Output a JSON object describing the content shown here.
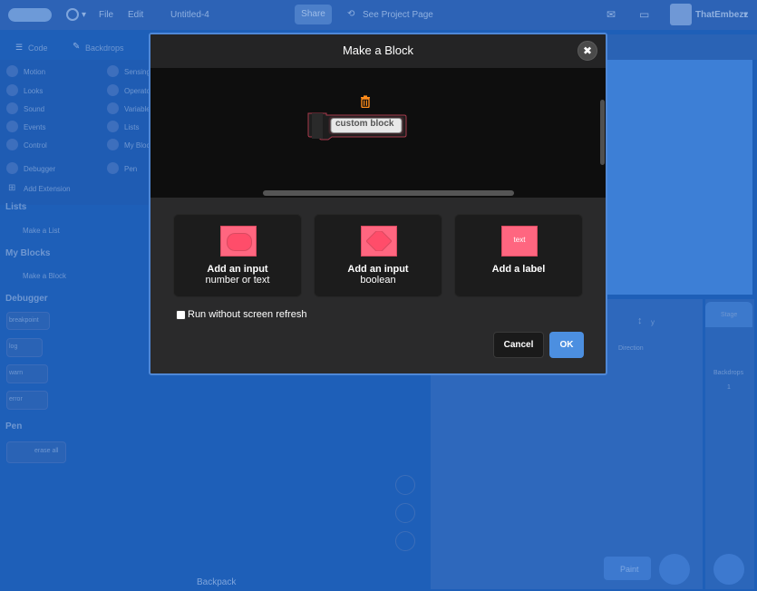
{
  "menubar": {
    "file_label": "File",
    "edit_label": "Edit",
    "project_title": "Untitled-4",
    "share_label": "Share",
    "see_project_label": "See Project Page",
    "username": "ThatEmbezz"
  },
  "tabs": {
    "code_label": "Code",
    "backdrops_label": "Backdrops"
  },
  "categories": [
    {
      "label": "Motion",
      "color": "#4c97ff"
    },
    {
      "label": "Looks",
      "color": "#9966ff"
    },
    {
      "label": "Sound",
      "color": "#cf63cf"
    },
    {
      "label": "Events",
      "color": "#ffbf00"
    },
    {
      "label": "Control",
      "color": "#ffab19"
    },
    {
      "label": "Debugger",
      "color": "#4c97ff"
    },
    {
      "label": "Sensing",
      "color": "#5cb1d6"
    },
    {
      "label": "Operators",
      "color": "#59c059"
    },
    {
      "label": "Variables",
      "color": "#ff8c1a"
    },
    {
      "label": "Lists",
      "color": "#ff661a"
    },
    {
      "label": "My Blocks",
      "color": "#ff6680"
    },
    {
      "label": "Pen",
      "color": "#0fbd8c"
    }
  ],
  "add_extension_label": "Add Extension",
  "palette": {
    "lists_heading": "Lists",
    "make_list_label": "Make a List",
    "my_blocks_heading": "My Blocks",
    "make_block_label": "Make a Block",
    "debugger_heading": "Debugger",
    "breakpoint_label": "breakpoint",
    "log_label": "log",
    "warn_label": "warn",
    "error_label": "error",
    "pen_heading": "Pen",
    "erase_all_label": "erase all"
  },
  "backpack_label": "Backpack",
  "sprite_pane": {
    "direction_label": "Direction",
    "y_label": "y"
  },
  "stage_pane": {
    "stage_label": "Stage",
    "backdrops_label": "Backdrops",
    "backdrop_count": "1"
  },
  "paint_label": "Paint",
  "modal": {
    "title": "Make a Block",
    "block_name": "custom block",
    "options": [
      {
        "title": "Add an input",
        "subtitle": "number or text",
        "icon": "round-input-icon"
      },
      {
        "title": "Add an input",
        "subtitle": "boolean",
        "icon": "hexagon-input-icon"
      },
      {
        "title": "Add a label",
        "subtitle": "",
        "icon": "label-icon",
        "icon_text": "text"
      }
    ],
    "checkbox_label": "Run without screen refresh",
    "checkbox_checked": false,
    "cancel_label": "Cancel",
    "ok_label": "OK",
    "block_color": "#ff6680",
    "ok_color": "#4c8fe0"
  }
}
